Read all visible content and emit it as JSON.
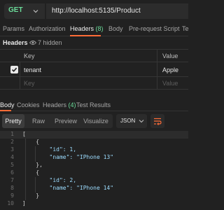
{
  "request": {
    "method": "GET",
    "url": "http://localhost:5135/Product"
  },
  "request_tabs": [
    {
      "label": "Params"
    },
    {
      "label": "Authorization"
    },
    {
      "label": "Headers",
      "count": "(8)"
    },
    {
      "label": "Body"
    },
    {
      "label": "Pre-request Script"
    },
    {
      "label": "Te"
    }
  ],
  "headers_panel": {
    "label": "Headers",
    "hidden_text": "7 hidden",
    "columns": {
      "key": "Key",
      "value": "Value"
    },
    "rows": [
      {
        "key": "tenant",
        "value": "Apple",
        "checked": true
      }
    ],
    "placeholder_row": {
      "key": "Key",
      "value": "Value"
    }
  },
  "response_tabs": [
    {
      "label": "Body"
    },
    {
      "label": "Cookies"
    },
    {
      "label": "Headers",
      "count": "(4)"
    },
    {
      "label": "Test Results"
    }
  ],
  "format_toolbar": {
    "options": [
      "Pretty",
      "Raw",
      "Preview",
      "Visualize"
    ],
    "selected": "Pretty",
    "language": "JSON"
  },
  "code_lines": [
    {
      "n": "1",
      "text": "["
    },
    {
      "n": "2",
      "text": "    {"
    },
    {
      "n": "3",
      "text": "        \"id\": 1,"
    },
    {
      "n": "4",
      "text": "        \"name\": \"IPhone 13\""
    },
    {
      "n": "5",
      "text": "    },"
    },
    {
      "n": "6",
      "text": "    {"
    },
    {
      "n": "7",
      "text": "        \"id\": 2,"
    },
    {
      "n": "8",
      "text": "        \"name\": \"IPhone 14\""
    },
    {
      "n": "9",
      "text": "    }"
    },
    {
      "n": "10",
      "text": "]"
    }
  ],
  "colors": {
    "accent": "#ff6c37",
    "method_get": "#6bdd9a",
    "count": "#6bdd9a",
    "background": "#212121"
  },
  "icons": [
    "chevron-down-icon",
    "eye-icon",
    "check-icon",
    "wrap-lines-icon"
  ]
}
